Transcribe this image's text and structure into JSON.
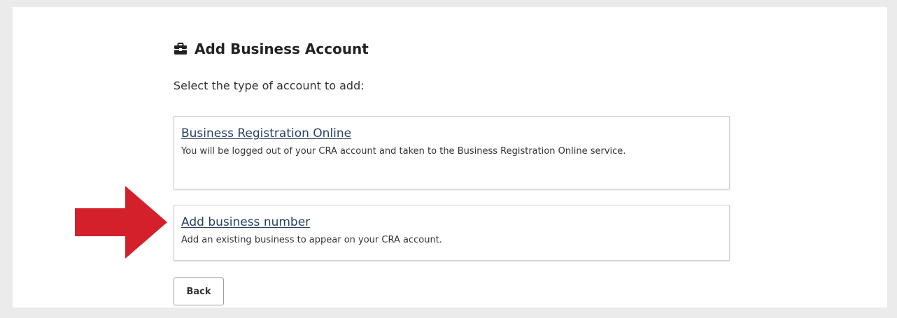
{
  "page": {
    "title": "Add Business Account",
    "title_icon": "briefcase-icon",
    "prompt": "Select the type of account to add:"
  },
  "options": [
    {
      "link": "Business Registration Online",
      "description": "You will be logged out of your CRA account and taken to the Business Registration Online service."
    },
    {
      "link": "Add business number",
      "description": "Add an existing business to appear on your CRA account."
    }
  ],
  "actions": {
    "back_label": "Back"
  },
  "colors": {
    "background": "#ebebeb",
    "panel": "#ffffff",
    "link": "#284162",
    "arrow": "#d3202a"
  },
  "annotation": {
    "arrow_icon": "arrow-right-icon"
  }
}
